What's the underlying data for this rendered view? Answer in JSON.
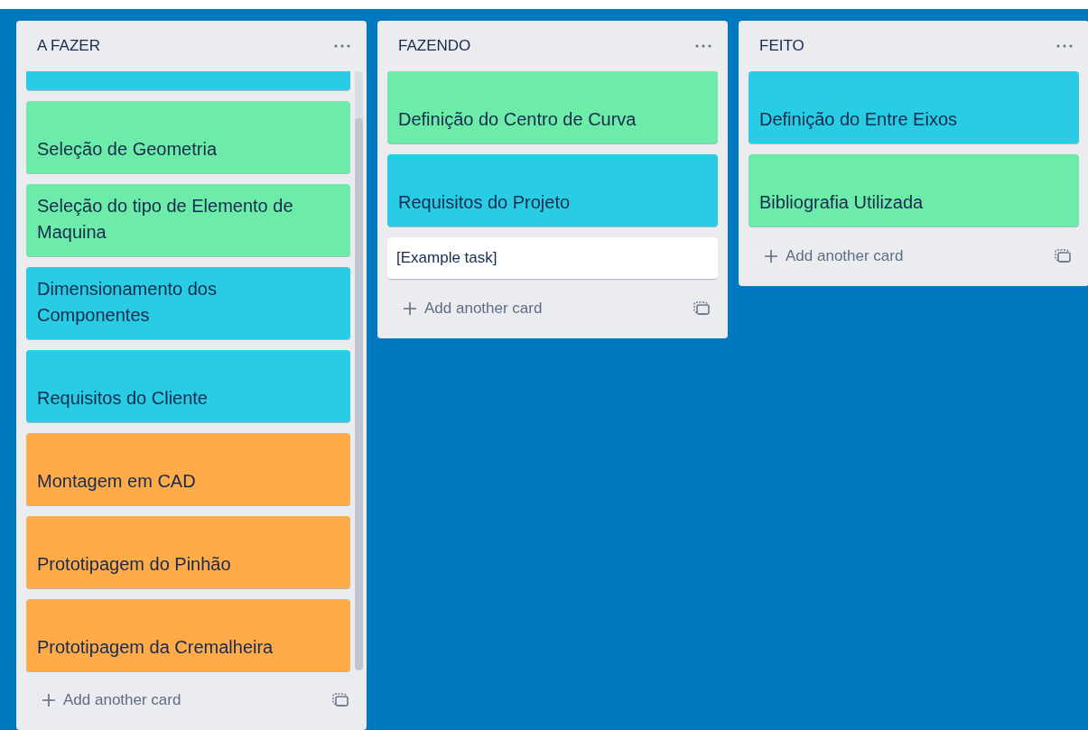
{
  "lists": [
    {
      "title": "A FAZER",
      "scrollable": true,
      "cards": [
        {
          "color": "#29cce5",
          "partial": true
        },
        {
          "text": "Seleção de Geometria",
          "color": "#6deca9"
        },
        {
          "text": "Seleção do tipo de Elemento de Maquina",
          "color": "#6deca9"
        },
        {
          "text": "Dimensionamento dos Componentes",
          "color": "#29cce5"
        },
        {
          "text": "Requisitos do Cliente",
          "color": "#29cce5"
        },
        {
          "text": "Montagem em CAD",
          "color": "#ffab4a"
        },
        {
          "text": "Prototipagem do Pinhão",
          "color": "#ffab4a"
        },
        {
          "text": "Prototipagem da Cremalheira",
          "color": "#ffab4a"
        }
      ],
      "add_label": "Add another card"
    },
    {
      "title": "FAZENDO",
      "scrollable": false,
      "cards": [
        {
          "text": "Definição do Centro de Curva",
          "color": "#6deca9"
        },
        {
          "text": "Requisitos do Projeto",
          "color": "#29cce5"
        },
        {
          "text": "[Example task]",
          "color": "#ffffff",
          "kind": "plain"
        }
      ],
      "add_label": "Add another card"
    },
    {
      "title": "FEITO",
      "scrollable": false,
      "cards": [
        {
          "text": "Definição do Entre Eixos",
          "color": "#29cce5"
        },
        {
          "text": "Bibliografia Utilizada",
          "color": "#6deca9"
        }
      ],
      "add_label": "Add another card"
    }
  ]
}
